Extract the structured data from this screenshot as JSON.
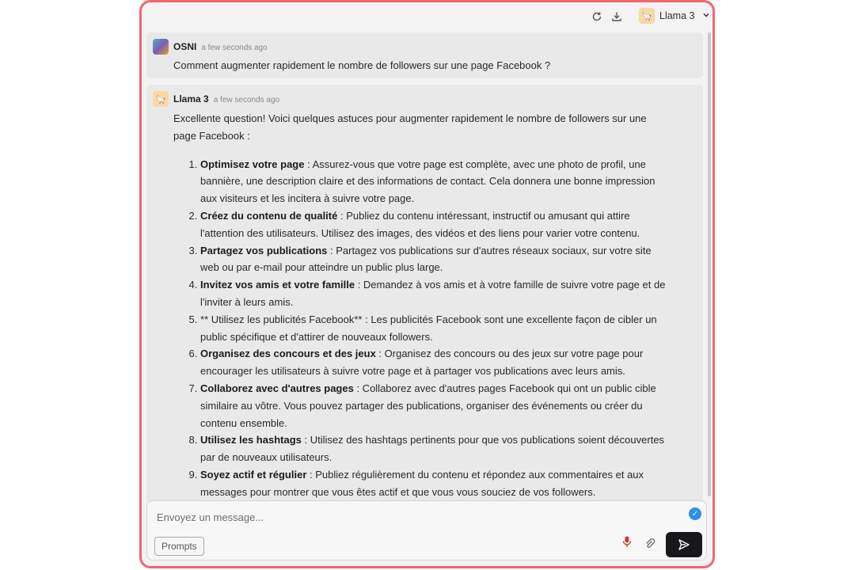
{
  "header": {
    "model_name": "Llama 3",
    "icons": [
      "refresh-icon",
      "download-icon",
      "chevron-down-icon"
    ]
  },
  "messages": [
    {
      "author": "OSNI",
      "time": "a few seconds ago",
      "text": "Comment augmenter rapidement le nombre de followers sur une page Facebook ?"
    },
    {
      "author": "Llama 3",
      "time": "a few seconds ago",
      "intro": "Excellente question! Voici quelques astuces pour augmenter rapidement le nombre de followers sur une page Facebook :",
      "items": [
        {
          "bold": "Optimisez votre page",
          "text": " : Assurez-vous que votre page est complète, avec une photo de profil, une bannière, une description claire et des informations de contact. Cela donnera une bonne impression aux visiteurs et les incitera à suivre votre page."
        },
        {
          "bold": "Créez du contenu de qualité",
          "text": " : Publiez du contenu intéressant, instructif ou amusant qui attire l'attention des utilisateurs. Utilisez des images, des vidéos et des liens pour varier votre contenu."
        },
        {
          "bold": "Partagez vos publications",
          "text": " : Partagez vos publications sur d'autres réseaux sociaux, sur votre site web ou par e-mail pour atteindre un public plus large."
        },
        {
          "bold": "Invitez vos amis et votre famille",
          "text": " : Demandez à vos amis et à votre famille de suivre votre page et de l'inviter à leurs amis."
        },
        {
          "bold": "",
          "text": "** Utilisez les publicités Facebook** : Les publicités Facebook sont une excellente façon de cibler un public spécifique et d'attirer de nouveaux followers."
        },
        {
          "bold": "Organisez des concours et des jeux",
          "text": " : Organisez des concours ou des jeux sur votre page pour encourager les utilisateurs à suivre votre page et à partager vos publications avec leurs amis."
        },
        {
          "bold": "Collaborez avec d'autres pages",
          "text": " : Collaborez avec d'autres pages Facebook qui ont un public cible similaire au vôtre. Vous pouvez partager des publications, organiser des événements ou créer du contenu ensemble."
        },
        {
          "bold": "Utilisez les hashtags",
          "text": " : Utilisez des hashtags pertinents pour que vos publications soient découvertes par de nouveaux utilisateurs."
        },
        {
          "bold": "Soyez actif et régulier",
          "text": " : Publiez régulièrement du contenu et répondez aux commentaires et aux messages pour montrer que vous êtes actif et que vous vous souciez de vos followers."
        }
      ]
    }
  ],
  "composer": {
    "placeholder": "Envoyez un message...",
    "prompts_label": "Prompts"
  },
  "colors": {
    "frame_border": "#f0676f",
    "send_button": "#17171c",
    "check_badge": "#2f8ee8",
    "mic": "#d33a2c"
  }
}
